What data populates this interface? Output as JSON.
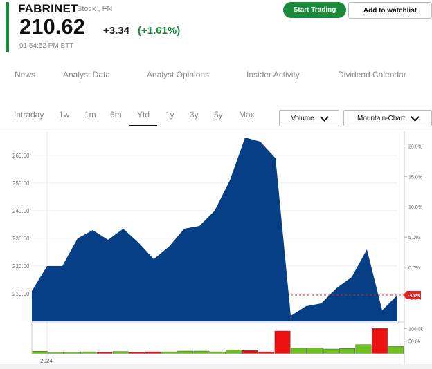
{
  "header": {
    "company": "FABRINET",
    "subtitle": "Stock , FN",
    "price": "210.62",
    "change": "+3.34",
    "change_pct": "(+1.61%)",
    "timestamp": "01:54:52 PM  BTT"
  },
  "actions": {
    "start_trading": "Start Trading",
    "add_watchlist": "Add to watchlist"
  },
  "nav_tabs": [
    "News",
    "Analyst Data",
    "Analyst Opinions",
    "Insider Activity",
    "Dividend Calendar"
  ],
  "active_nav_tab": "News",
  "ranges": [
    "Intraday",
    "1w",
    "1m",
    "6m",
    "Ytd",
    "1y",
    "3y",
    "5y",
    "Max"
  ],
  "active_range": "Ytd",
  "dropdowns": {
    "volume": "Volume",
    "chart_type": "Mountain-Chart"
  },
  "colors": {
    "accent_green": "#1a8a3a",
    "area_fill": "#063f86",
    "volume_up": "#6cc21b",
    "volume_down": "#ee1111",
    "badge": "#e02424"
  },
  "chart_data": {
    "type": "area",
    "ylim": [
      200,
      269
    ],
    "y_ticks": [
      "260.00",
      "250.00",
      "240.00",
      "230.00",
      "220.00",
      "210.00"
    ],
    "y_tick_values": [
      260,
      250,
      240,
      230,
      220,
      210
    ],
    "pct_ticks": [
      "20.0%",
      "15.0%",
      "10.0%",
      "5.0%",
      "0.0%",
      "-5.0%"
    ],
    "pct_tick_values": [
      20,
      15,
      10,
      5,
      0,
      -5
    ],
    "price_values": [
      211,
      220,
      220,
      230,
      233,
      229.5,
      233.5,
      228.5,
      222.5,
      227,
      233.5,
      234.5,
      240,
      251,
      266.5,
      265,
      259,
      202,
      205.5,
      206.5,
      212,
      216,
      226,
      204,
      209.5
    ],
    "current_marker": "-4.8%",
    "current_marker_value": 209.5,
    "x_labels": [
      "2024"
    ],
    "volume_ticks": [
      "100.0k",
      "50.0k"
    ],
    "volume_tick_values": [
      100,
      50
    ],
    "volume_max": 120,
    "volume_values": [
      10,
      6,
      6,
      8,
      6,
      9,
      6,
      8,
      8,
      11,
      11,
      8,
      15,
      13,
      8,
      90,
      22,
      23,
      19,
      21,
      36,
      100,
      29
    ],
    "volume_direction": [
      "up",
      "up",
      "up",
      "up",
      "down",
      "up",
      "down",
      "down",
      "up",
      "up",
      "up",
      "up",
      "up",
      "down",
      "down",
      "down",
      "up",
      "up",
      "up",
      "up",
      "up",
      "down",
      "up"
    ]
  }
}
